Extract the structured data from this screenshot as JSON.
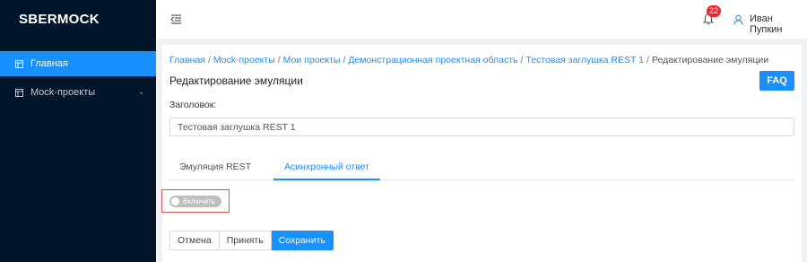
{
  "app": {
    "logo": "SBERMOCK"
  },
  "sidebar": {
    "items": [
      {
        "label": "Главная",
        "icon": "layout-icon",
        "active": true
      },
      {
        "label": "Mock-проекты",
        "icon": "layout-icon",
        "expandable": true
      }
    ]
  },
  "header": {
    "notifications_count": "22",
    "user_name": "Иван Пупкин"
  },
  "breadcrumb": {
    "items": [
      "Главная",
      "Mock-проекты",
      "Мои проекты",
      "Демонстрационная проектная область",
      "Тестовая заглушка REST 1",
      "Редактирование эмуляции"
    ],
    "separator": "/"
  },
  "page": {
    "title": "Редактирование эмуляции",
    "faq_label": "FAQ",
    "title_field_label": "Заголовок:",
    "title_field_value": "Тестовая заглушка REST 1"
  },
  "tabs": [
    {
      "label": "Эмуляция REST",
      "active": false
    },
    {
      "label": "Асинхронный ответ",
      "active": true
    }
  ],
  "toggle": {
    "label": "Включить",
    "checked": false
  },
  "actions": {
    "cancel_label": "Отмена",
    "accept_label": "Принять",
    "save_label": "Сохранить"
  },
  "colors": {
    "sidebar_bg": "#001529",
    "accent": "#1890ff",
    "badge": "#f5222d",
    "highlight_frame": "#d9534f"
  }
}
